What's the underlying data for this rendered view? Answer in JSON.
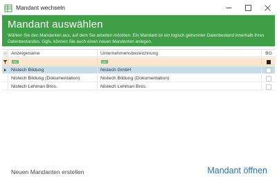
{
  "window": {
    "title": "Mandant wechseln",
    "icon": "grid-app-icon"
  },
  "header": {
    "title": "Mandant auswählen",
    "description": "Wählen Sie den Mandanten aus, auf dem Sie arbeiten möchten. Ein Mandant ist ein logisch getrennter Datenbestand innerhalb Ihres Datenbestandes. Ggfs. können Sie auch einen neuen Mandanten anlegen.",
    "background": "#3f9f47"
  },
  "grid": {
    "columns": {
      "name": "Anzeigename",
      "company": "Unternehmensbezeichnung",
      "bg": "BG"
    },
    "filter": {
      "name_glyph": "ABC",
      "company_glyph": "ABC"
    },
    "rows": [
      {
        "name": "Nistech Bildung",
        "company": "Nistech GmbH",
        "bg": false,
        "selected": true
      },
      {
        "name": "Nistech Bildung (Dokumentation)",
        "company": "Nistech Bildung (Dokumentation)",
        "bg": false,
        "selected": false
      },
      {
        "name": "Nistech Lehman Bros.",
        "company": "Nistech Lehman Bros.",
        "bg": false,
        "selected": false
      }
    ]
  },
  "footer": {
    "create_label": "Neuen Mandanten erstellen",
    "open_label": "Mandant öffnen"
  }
}
